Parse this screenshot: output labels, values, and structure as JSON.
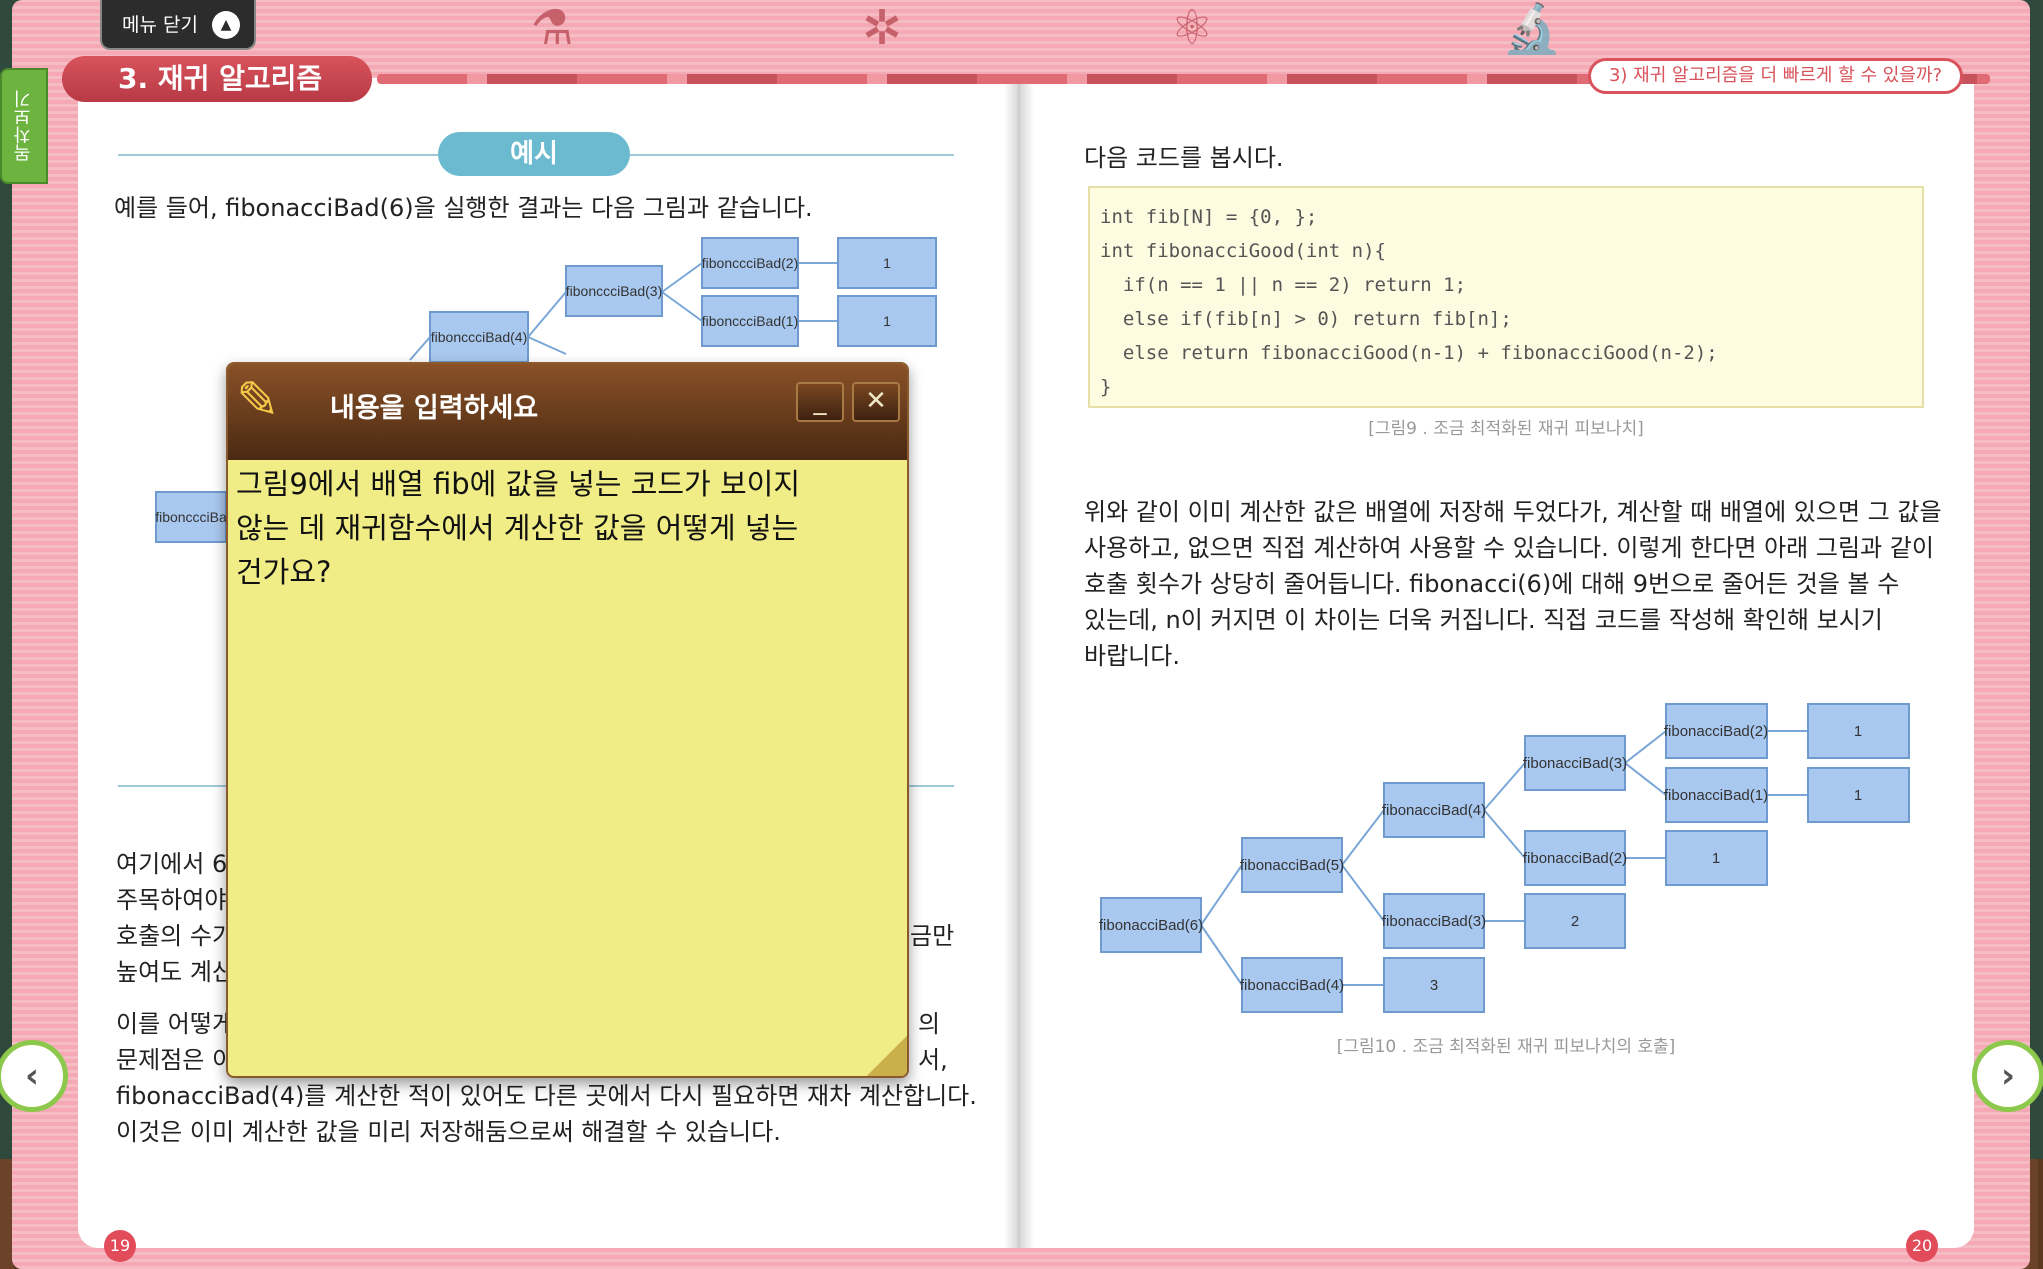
{
  "top": {
    "menu_label": "메뉴 닫기",
    "chapter_title": "3. 재귀 알고리즘",
    "section_title": "3) 재귀 알고리즘을 더 빠르게 할 수 있을까?",
    "toc_label": "목차보기"
  },
  "left_page": {
    "example_label": "예시",
    "intro": "예를 들어, fibonacciBad(6)을 실행한 결과는 다음 그림과 같습니다.",
    "para1_lines": [
      "여기에서 6",
      "주목하여야",
      "호출의 수가",
      "높여도 계산"
    ],
    "para1_tail": "금만",
    "para2_head_lines": [
      "이를 어떻게",
      "문제점은 이"
    ],
    "para2_tail": [
      "의",
      "서,"
    ],
    "para2_full1": "fibonacciBad(4)를 계산한 적이 있어도 다른 곳에서 다시 필요하면 재차 계산합니다.",
    "para2_full2": "이것은 이미 계산한 값을 미리 저장해둠으로써 해결할 수 있습니다.",
    "page_number": "19",
    "tree_labels": {
      "n_bad2": "fibonccciBad(2)",
      "n_bad3": "fibonccciBad(3)",
      "n_bad1": "fibonccciBad(1)",
      "n_bad4": "fibonccciBad(4)",
      "n_badL": "fibonccciBa",
      "leaf1a": "1",
      "leaf1b": "1"
    }
  },
  "right_page": {
    "lead": "다음 코드를 봅시다.",
    "code_lines": [
      "int fib[N] = {0, };",
      "int fibonacciGood(int n){",
      "  if(n == 1 || n == 2) return 1;",
      "  else if(fib[n] > 0) return fib[n];",
      "  else return fibonacciGood(n-1) + fibonacciGood(n-2);",
      "}"
    ],
    "code_caption": "[그림9 . 조금 최적화된 재귀 피보나치]",
    "body_lines": [
      "위와 같이 이미 계산한 값은 배열에 저장해 두었다가, 계산할 때 배열에 있으면 그 값을",
      "사용하고, 없으면 직접 계산하여 사용할 수 있습니다. 이렇게 한다면 아래 그림과 같이",
      "호출 횟수가 상당히 줄어듭니다. fibonacci(6)에 대해 9번으로 줄어든 것을 볼 수",
      "있는데, n이 커지면 이 차이는 더욱 커집니다. 직접 코드를 작성해 확인해 보시기",
      "바랍니다."
    ],
    "tree_caption": "[그림10 . 조금 최적화된 재귀 피보나치의 호출]",
    "page_number": "20",
    "tree_labels": {
      "n6": "fibonacciBad(6)",
      "n5": "fibonacciBad(5)",
      "n4a": "fibonacciBad(4)",
      "n4b": "fibonacciBad(4)",
      "n3a": "fibonacciBad(3)",
      "n3b": "fibonacciBad(3)",
      "n2a": "fibonacciBad(2)",
      "n2b": "fibonacciBad(2)",
      "n1": "fibonacciBad(1)",
      "v1a": "1",
      "v1b": "1",
      "v1c": "1",
      "v2": "2",
      "v3": "3"
    }
  },
  "memo": {
    "title": "내용을 입력하세요",
    "minimize_symbol": "_",
    "close_symbol": "✕",
    "text_lines": [
      "그림9에서 배열 fib에 값을 넣는 코드가 보이지",
      "않는 데 재귀함수에서 계산한 값을 어떻게 넣는",
      "건가요?"
    ]
  },
  "nav": {
    "prev_symbol": "‹",
    "next_symbol": "›"
  },
  "colors": {
    "accent_red": "#d9535c",
    "node_blue": "#8fb5e6",
    "memo_yellow": "#f0ec86",
    "memo_brown": "#5e3418",
    "toc_green": "#6cb33f"
  }
}
